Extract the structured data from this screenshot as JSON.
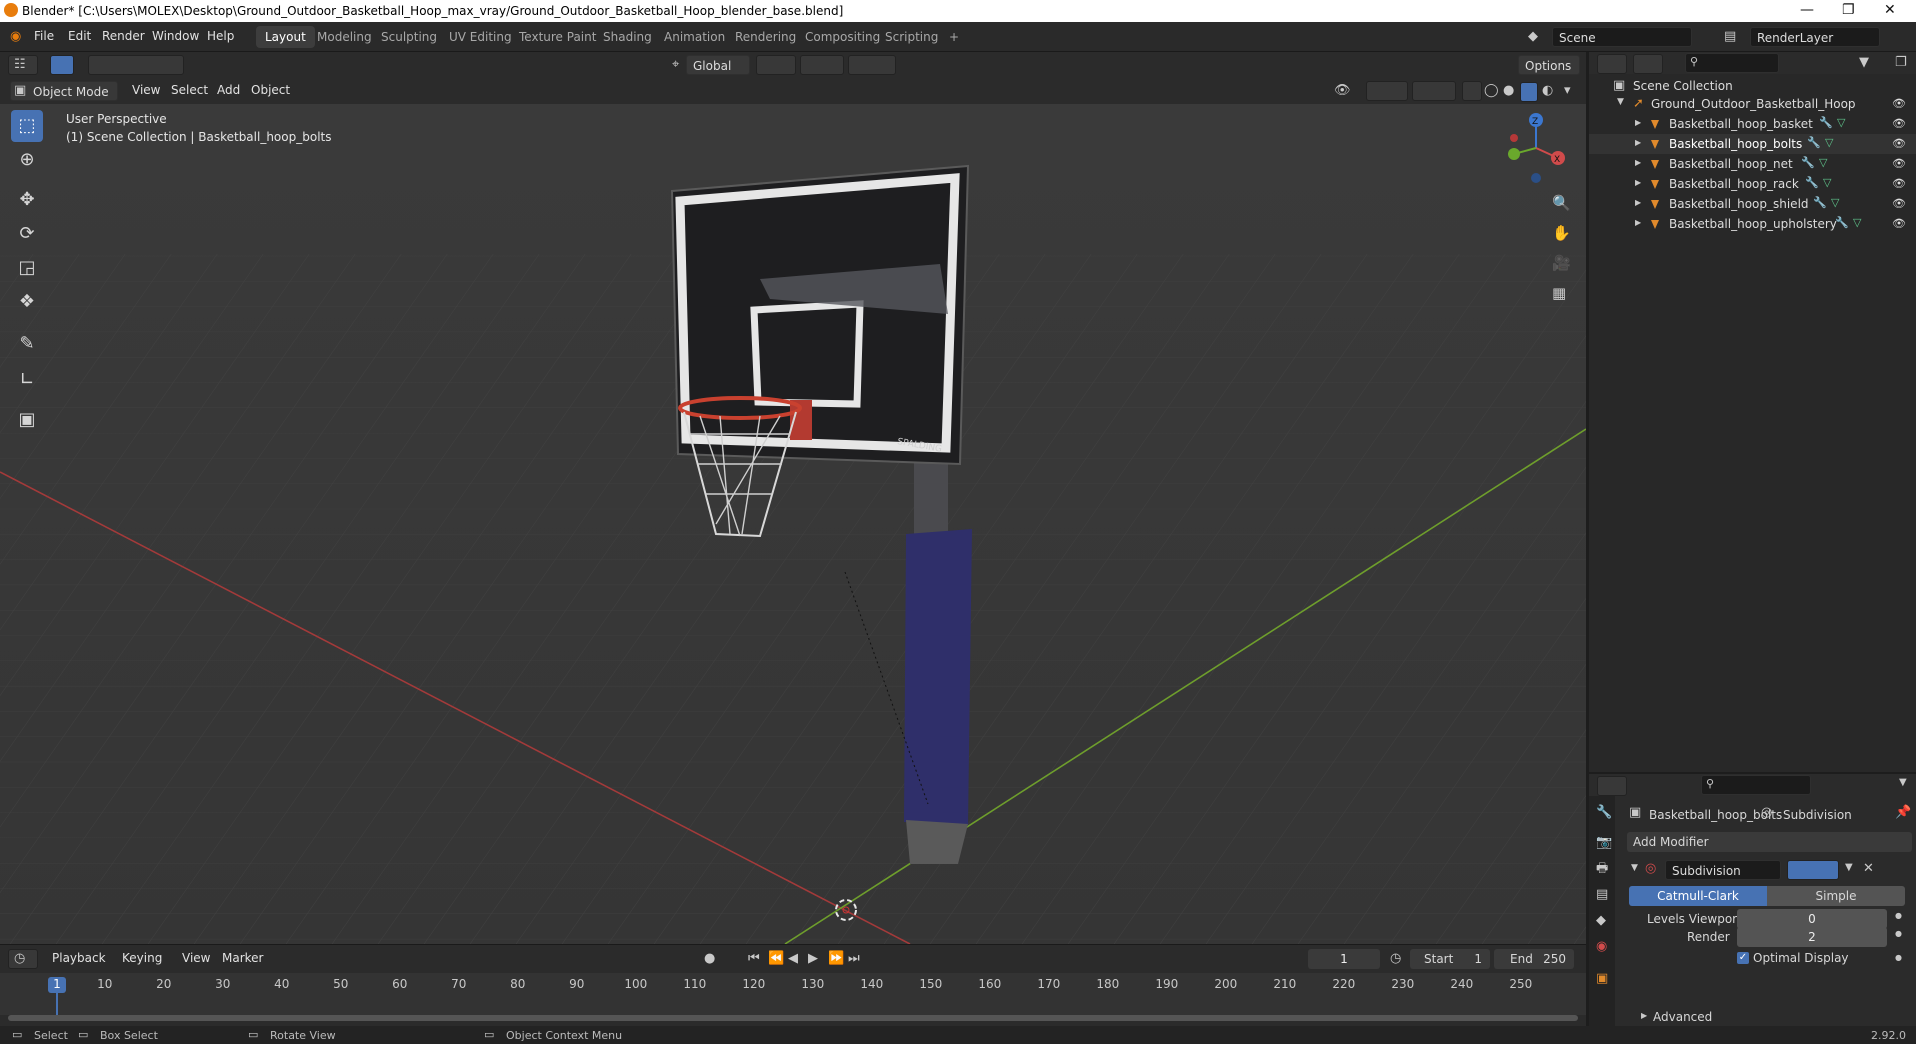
{
  "window": {
    "title": "Blender* [C:\\Users\\MOLEX\\Desktop\\Ground_Outdoor_Basketball_Hoop_max_vray/Ground_Outdoor_Basketball_Hoop_blender_base.blend]"
  },
  "menubar": {
    "items": [
      "File",
      "Edit",
      "Render",
      "Window",
      "Help"
    ]
  },
  "workspaces": {
    "tabs": [
      "Layout",
      "Modeling",
      "Sculpting",
      "UV Editing",
      "Texture Paint",
      "Shading",
      "Animation",
      "Rendering",
      "Compositing",
      "Scripting"
    ],
    "add": "+"
  },
  "scene": {
    "scene_name": "Scene",
    "render_layer": "RenderLayer"
  },
  "viewport_header": {
    "transform_orientation": "Global",
    "options": "Options",
    "mode": "Object Mode",
    "menus": [
      "View",
      "Select",
      "Add",
      "Object"
    ]
  },
  "viewport": {
    "perspective_label": "User Perspective",
    "collection_label": "(1) Scene Collection | Basketball_hoop_bolts",
    "backboard_brand": "SPALDING",
    "gizmo_axes": [
      "X",
      "Y",
      "Z"
    ]
  },
  "outliner": {
    "root": "Scene Collection",
    "collection": "Ground_Outdoor_Basketball_Hoop",
    "objects": [
      "Basketball_hoop_basket",
      "Basketball_hoop_bolts",
      "Basketball_hoop_net",
      "Basketball_hoop_rack",
      "Basketball_hoop_shield",
      "Basketball_hoop_upholstery"
    ]
  },
  "properties": {
    "object_name": "Basketball_hoop_bolts",
    "modifier_tab": "Subdivision",
    "add_modifier": "Add Modifier",
    "modifier_name": "Subdivision",
    "type_options": [
      "Catmull-Clark",
      "Simple"
    ],
    "selected_type": "Catmull-Clark",
    "levels_viewport_label": "Levels Viewport",
    "levels_viewport": "0",
    "render_label": "Render",
    "render_levels": "2",
    "optimal_display_label": "Optimal Display",
    "optimal_display": true,
    "advanced_label": "Advanced"
  },
  "timeline": {
    "menus": [
      "Playback",
      "Keying",
      "View",
      "Marker"
    ],
    "current_frame": "1",
    "start_label": "Start",
    "start": "1",
    "end_label": "End",
    "end": "250",
    "ticks": [
      "1",
      "10",
      "20",
      "30",
      "40",
      "50",
      "60",
      "70",
      "80",
      "90",
      "100",
      "110",
      "120",
      "130",
      "140",
      "150",
      "160",
      "170",
      "180",
      "190",
      "200",
      "210",
      "220",
      "230",
      "240",
      "250"
    ]
  },
  "statusbar": {
    "select": "Select",
    "box_select": "Box Select",
    "rotate_view": "Rotate View",
    "context_menu": "Object Context Menu",
    "version": "2.92.0"
  },
  "colors": {
    "accent": "#4772b3",
    "x_axis": "#a33a3a",
    "y_axis": "#6e9e2c",
    "object_icon": "#e08a2c",
    "pad_blue": "#2f2f6a"
  }
}
